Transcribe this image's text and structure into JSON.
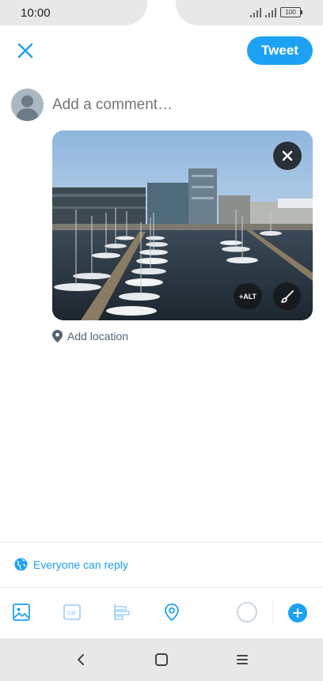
{
  "status_bar": {
    "time": "10:00",
    "battery": "100"
  },
  "header": {
    "tweet_label": "Tweet"
  },
  "composer": {
    "placeholder": "Add a comment…"
  },
  "media": {
    "alt_label": "+ALT"
  },
  "location": {
    "label": "Add location"
  },
  "reply_setting": {
    "label": "Everyone can reply"
  },
  "colors": {
    "accent": "#1da1f2",
    "muted": "#657786"
  },
  "toolbar": {
    "icons": [
      "image-icon",
      "gif-icon",
      "poll-icon",
      "location-icon",
      "progress-ring",
      "add-thread-icon"
    ]
  },
  "navbar": {
    "icons": [
      "back-icon",
      "home-icon",
      "recents-icon"
    ]
  }
}
